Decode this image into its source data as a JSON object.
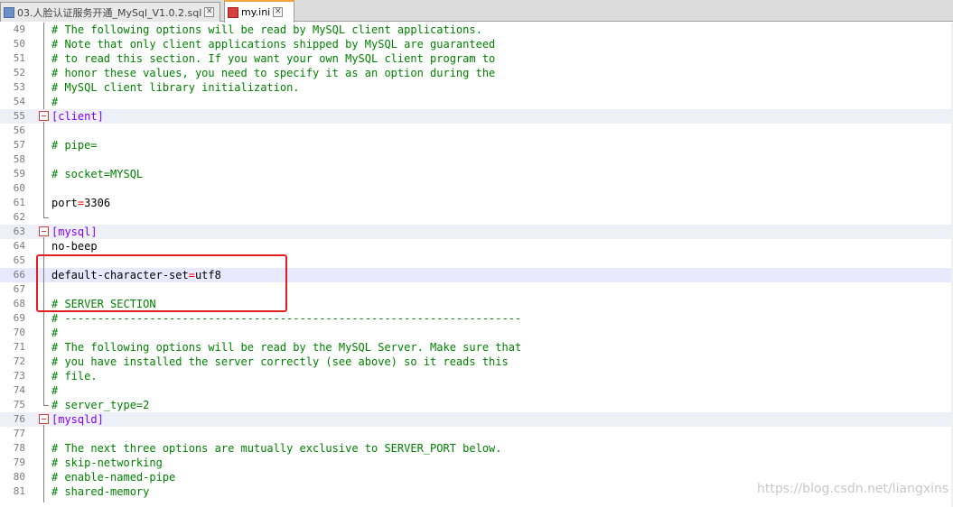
{
  "tabs": [
    {
      "label": "03.人脸认证服务开通_MySql_V1.0.2.sql",
      "icon": "sql-file-icon",
      "active": false
    },
    {
      "label": "my.ini",
      "icon": "ini-file-icon",
      "active": true
    }
  ],
  "lines": [
    {
      "n": "49",
      "segs": [
        {
          "t": "# The following options will be read by MySQL client applications.",
          "c": "c-comment"
        }
      ]
    },
    {
      "n": "50",
      "segs": [
        {
          "t": "# Note that only client applications shipped by MySQL are guaranteed",
          "c": "c-comment"
        }
      ]
    },
    {
      "n": "51",
      "segs": [
        {
          "t": "# to read this section. If you want your own MySQL client program to",
          "c": "c-comment"
        }
      ]
    },
    {
      "n": "52",
      "segs": [
        {
          "t": "# honor these values, you need to specify it as an option during the",
          "c": "c-comment"
        }
      ]
    },
    {
      "n": "53",
      "segs": [
        {
          "t": "# MySQL client library initialization.",
          "c": "c-comment"
        }
      ]
    },
    {
      "n": "54",
      "segs": [
        {
          "t": "#",
          "c": "c-comment"
        }
      ]
    },
    {
      "n": "55",
      "segs": [
        {
          "t": "[client]",
          "c": "c-section"
        }
      ],
      "section": true
    },
    {
      "n": "56",
      "segs": []
    },
    {
      "n": "57",
      "segs": [
        {
          "t": "# pipe=",
          "c": "c-comment"
        }
      ]
    },
    {
      "n": "58",
      "segs": []
    },
    {
      "n": "59",
      "segs": [
        {
          "t": "# socket=MYSQL",
          "c": "c-comment"
        }
      ]
    },
    {
      "n": "60",
      "segs": []
    },
    {
      "n": "61",
      "segs": [
        {
          "t": "port",
          "c": "c-key"
        },
        {
          "t": "=",
          "c": "c-eq"
        },
        {
          "t": "3306",
          "c": "c-val"
        }
      ]
    },
    {
      "n": "62",
      "segs": []
    },
    {
      "n": "63",
      "segs": [
        {
          "t": "[mysql]",
          "c": "c-section"
        }
      ],
      "section": true
    },
    {
      "n": "64",
      "segs": [
        {
          "t": "no-beep",
          "c": "c-key"
        }
      ]
    },
    {
      "n": "65",
      "segs": []
    },
    {
      "n": "66",
      "segs": [
        {
          "t": "default-character-set",
          "c": "c-key"
        },
        {
          "t": "=",
          "c": "c-eq"
        },
        {
          "t": "utf8",
          "c": "c-val"
        }
      ],
      "current": true
    },
    {
      "n": "67",
      "segs": []
    },
    {
      "n": "68",
      "segs": [
        {
          "t": "# SERVER SECTION",
          "c": "c-comment"
        }
      ]
    },
    {
      "n": "69",
      "segs": [
        {
          "t": "# ----------------------------------------------------------------------",
          "c": "c-comment"
        }
      ]
    },
    {
      "n": "70",
      "segs": [
        {
          "t": "#",
          "c": "c-comment"
        }
      ]
    },
    {
      "n": "71",
      "segs": [
        {
          "t": "# The following options will be read by the MySQL Server. Make sure that",
          "c": "c-comment"
        }
      ]
    },
    {
      "n": "72",
      "segs": [
        {
          "t": "# you have installed the server correctly (see above) so it reads this",
          "c": "c-comment"
        }
      ]
    },
    {
      "n": "73",
      "segs": [
        {
          "t": "# file.",
          "c": "c-comment"
        }
      ]
    },
    {
      "n": "74",
      "segs": [
        {
          "t": "#",
          "c": "c-comment"
        }
      ]
    },
    {
      "n": "75",
      "segs": [
        {
          "t": "# server_type=2",
          "c": "c-comment"
        }
      ]
    },
    {
      "n": "76",
      "segs": [
        {
          "t": "[mysqld]",
          "c": "c-section"
        }
      ],
      "section": true
    },
    {
      "n": "77",
      "segs": []
    },
    {
      "n": "78",
      "segs": [
        {
          "t": "# The next three options are mutually exclusive to SERVER_PORT below.",
          "c": "c-comment"
        }
      ]
    },
    {
      "n": "79",
      "segs": [
        {
          "t": "# skip-networking",
          "c": "c-comment"
        }
      ]
    },
    {
      "n": "80",
      "segs": [
        {
          "t": "# enable-named-pipe",
          "c": "c-comment"
        }
      ]
    },
    {
      "n": "81",
      "segs": [
        {
          "t": "# shared-memory",
          "c": "c-comment"
        }
      ]
    }
  ],
  "watermark": "https://blog.csdn.net/liangxins",
  "colors": {
    "comment": "#008000",
    "section": "#8000ff",
    "operator": "#ff0000",
    "annotation_box": "#e02020",
    "active_tab_accent": "#f2a33a"
  }
}
